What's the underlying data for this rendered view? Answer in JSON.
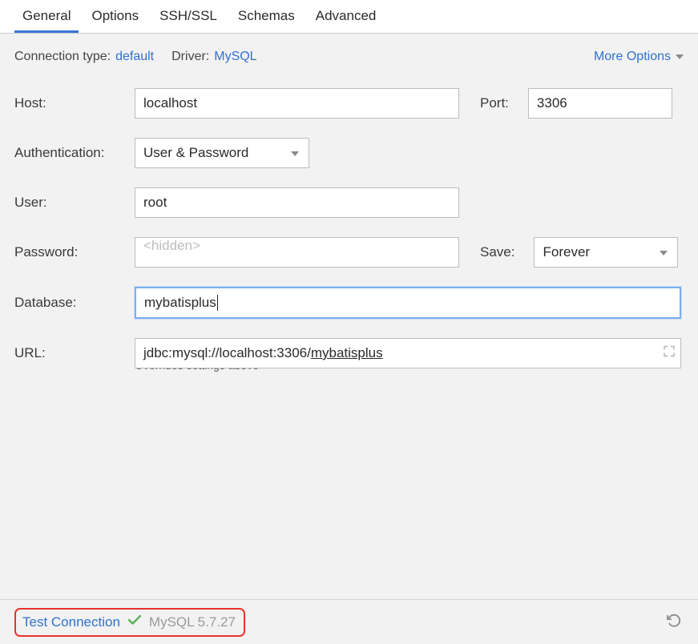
{
  "tabs": [
    "General",
    "Options",
    "SSH/SSL",
    "Schemas",
    "Advanced"
  ],
  "top": {
    "connection_type_label": "Connection type:",
    "connection_type_value": "default",
    "driver_label": "Driver:",
    "driver_value": "MySQL",
    "more_options": "More Options"
  },
  "labels": {
    "host": "Host:",
    "port": "Port:",
    "auth": "Authentication:",
    "user": "User:",
    "password": "Password:",
    "save": "Save:",
    "database": "Database:",
    "url": "URL:"
  },
  "values": {
    "host": "localhost",
    "port": "3306",
    "auth": "User & Password",
    "user": "root",
    "password_placeholder": "<hidden>",
    "save_mode": "Forever",
    "database": "mybatisplus",
    "url_prefix": "jdbc:mysql://localhost:3306/",
    "url_db": "mybatisplus"
  },
  "hint": "Overrides settings above",
  "footer": {
    "test_connection": "Test Connection",
    "version": "MySQL 5.7.27"
  }
}
